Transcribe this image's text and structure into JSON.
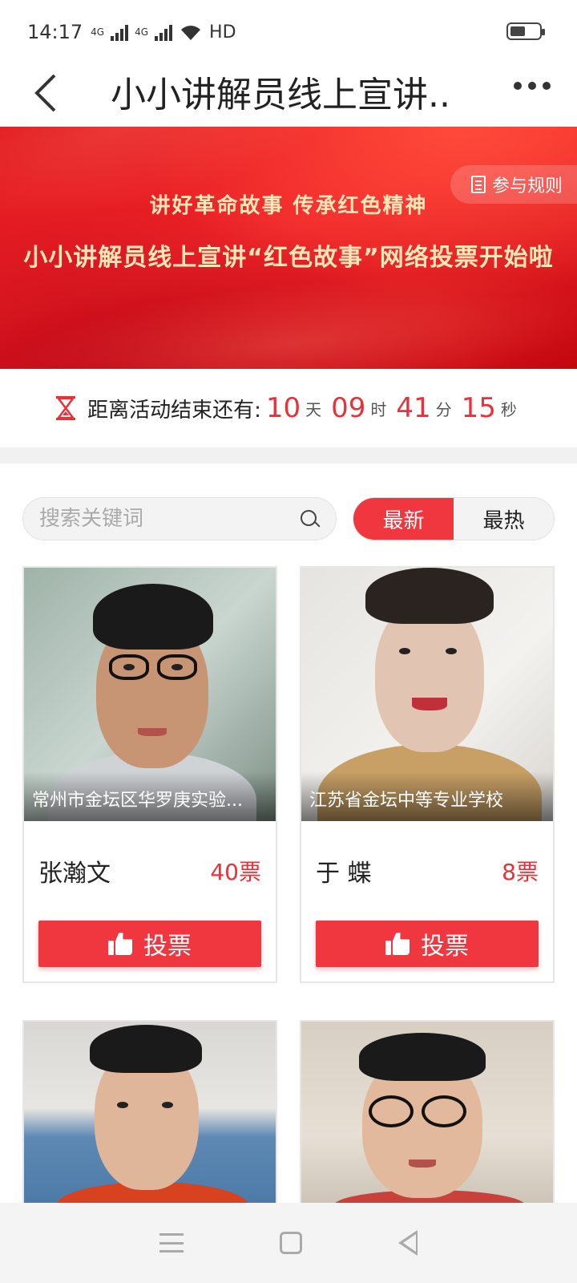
{
  "status_bar": {
    "time": "14:17",
    "network_1": "4G",
    "network_2": "4G",
    "hd_label": "HD",
    "wifi_icon": "wifi-icon",
    "battery_icon": "battery-icon"
  },
  "nav": {
    "title": "小小讲解员线上宣讲..",
    "back_icon": "chevron-left-icon",
    "more_icon": "more-dots-icon"
  },
  "banner": {
    "line1": "讲好革命故事 传承红色精神",
    "line2": "小小讲解员线上宣讲“红色故事”网络投票开始啦",
    "rules_label": "参与规则"
  },
  "countdown": {
    "label": "距离活动结束还有:",
    "days": "10",
    "days_unit": "天",
    "hours": "09",
    "hours_unit": "时",
    "minutes": "41",
    "minutes_unit": "分",
    "seconds": "15",
    "seconds_unit": "秒"
  },
  "search": {
    "placeholder": "搜索关键词"
  },
  "sort_tabs": {
    "latest": "最新",
    "hottest": "最热",
    "active": "latest"
  },
  "candidates": [
    {
      "name": "张瀚文",
      "school": "常州市金坛区华罗庚实验...",
      "votes": "40票",
      "vote_label": "投票"
    },
    {
      "name": "于 蝶",
      "school": "江苏省金坛中等专业学校",
      "votes": "8票",
      "vote_label": "投票"
    },
    {
      "name": "",
      "school": "",
      "votes": "",
      "vote_label": ""
    },
    {
      "name": "",
      "school": "",
      "votes": "",
      "vote_label": ""
    }
  ],
  "colors": {
    "accent": "#f0363f",
    "vote_text": "#e9313a",
    "banner_text": "#ffe7b8"
  }
}
